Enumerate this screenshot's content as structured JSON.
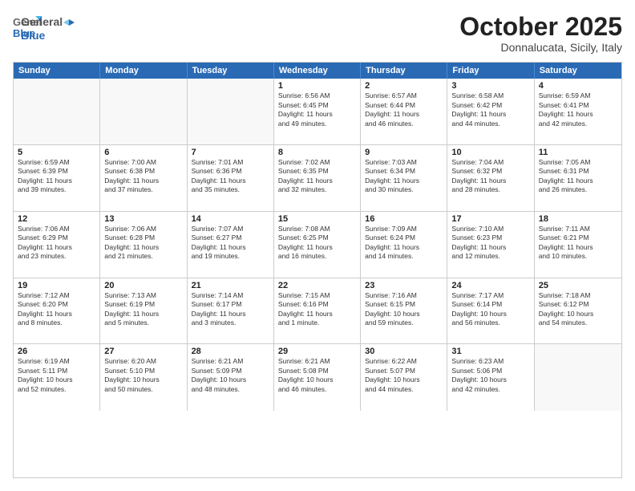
{
  "header": {
    "logo": {
      "general": "General",
      "blue": "Blue"
    },
    "title": "October 2025",
    "location": "Donnalucata, Sicily, Italy"
  },
  "dayHeaders": [
    "Sunday",
    "Monday",
    "Tuesday",
    "Wednesday",
    "Thursday",
    "Friday",
    "Saturday"
  ],
  "weeks": [
    [
      {
        "date": "",
        "info": ""
      },
      {
        "date": "",
        "info": ""
      },
      {
        "date": "",
        "info": ""
      },
      {
        "date": "1",
        "info": "Sunrise: 6:56 AM\nSunset: 6:45 PM\nDaylight: 11 hours\nand 49 minutes."
      },
      {
        "date": "2",
        "info": "Sunrise: 6:57 AM\nSunset: 6:44 PM\nDaylight: 11 hours\nand 46 minutes."
      },
      {
        "date": "3",
        "info": "Sunrise: 6:58 AM\nSunset: 6:42 PM\nDaylight: 11 hours\nand 44 minutes."
      },
      {
        "date": "4",
        "info": "Sunrise: 6:59 AM\nSunset: 6:41 PM\nDaylight: 11 hours\nand 42 minutes."
      }
    ],
    [
      {
        "date": "5",
        "info": "Sunrise: 6:59 AM\nSunset: 6:39 PM\nDaylight: 11 hours\nand 39 minutes."
      },
      {
        "date": "6",
        "info": "Sunrise: 7:00 AM\nSunset: 6:38 PM\nDaylight: 11 hours\nand 37 minutes."
      },
      {
        "date": "7",
        "info": "Sunrise: 7:01 AM\nSunset: 6:36 PM\nDaylight: 11 hours\nand 35 minutes."
      },
      {
        "date": "8",
        "info": "Sunrise: 7:02 AM\nSunset: 6:35 PM\nDaylight: 11 hours\nand 32 minutes."
      },
      {
        "date": "9",
        "info": "Sunrise: 7:03 AM\nSunset: 6:34 PM\nDaylight: 11 hours\nand 30 minutes."
      },
      {
        "date": "10",
        "info": "Sunrise: 7:04 AM\nSunset: 6:32 PM\nDaylight: 11 hours\nand 28 minutes."
      },
      {
        "date": "11",
        "info": "Sunrise: 7:05 AM\nSunset: 6:31 PM\nDaylight: 11 hours\nand 26 minutes."
      }
    ],
    [
      {
        "date": "12",
        "info": "Sunrise: 7:06 AM\nSunset: 6:29 PM\nDaylight: 11 hours\nand 23 minutes."
      },
      {
        "date": "13",
        "info": "Sunrise: 7:06 AM\nSunset: 6:28 PM\nDaylight: 11 hours\nand 21 minutes."
      },
      {
        "date": "14",
        "info": "Sunrise: 7:07 AM\nSunset: 6:27 PM\nDaylight: 11 hours\nand 19 minutes."
      },
      {
        "date": "15",
        "info": "Sunrise: 7:08 AM\nSunset: 6:25 PM\nDaylight: 11 hours\nand 16 minutes."
      },
      {
        "date": "16",
        "info": "Sunrise: 7:09 AM\nSunset: 6:24 PM\nDaylight: 11 hours\nand 14 minutes."
      },
      {
        "date": "17",
        "info": "Sunrise: 7:10 AM\nSunset: 6:23 PM\nDaylight: 11 hours\nand 12 minutes."
      },
      {
        "date": "18",
        "info": "Sunrise: 7:11 AM\nSunset: 6:21 PM\nDaylight: 11 hours\nand 10 minutes."
      }
    ],
    [
      {
        "date": "19",
        "info": "Sunrise: 7:12 AM\nSunset: 6:20 PM\nDaylight: 11 hours\nand 8 minutes."
      },
      {
        "date": "20",
        "info": "Sunrise: 7:13 AM\nSunset: 6:19 PM\nDaylight: 11 hours\nand 5 minutes."
      },
      {
        "date": "21",
        "info": "Sunrise: 7:14 AM\nSunset: 6:17 PM\nDaylight: 11 hours\nand 3 minutes."
      },
      {
        "date": "22",
        "info": "Sunrise: 7:15 AM\nSunset: 6:16 PM\nDaylight: 11 hours\nand 1 minute."
      },
      {
        "date": "23",
        "info": "Sunrise: 7:16 AM\nSunset: 6:15 PM\nDaylight: 10 hours\nand 59 minutes."
      },
      {
        "date": "24",
        "info": "Sunrise: 7:17 AM\nSunset: 6:14 PM\nDaylight: 10 hours\nand 56 minutes."
      },
      {
        "date": "25",
        "info": "Sunrise: 7:18 AM\nSunset: 6:12 PM\nDaylight: 10 hours\nand 54 minutes."
      }
    ],
    [
      {
        "date": "26",
        "info": "Sunrise: 6:19 AM\nSunset: 5:11 PM\nDaylight: 10 hours\nand 52 minutes."
      },
      {
        "date": "27",
        "info": "Sunrise: 6:20 AM\nSunset: 5:10 PM\nDaylight: 10 hours\nand 50 minutes."
      },
      {
        "date": "28",
        "info": "Sunrise: 6:21 AM\nSunset: 5:09 PM\nDaylight: 10 hours\nand 48 minutes."
      },
      {
        "date": "29",
        "info": "Sunrise: 6:21 AM\nSunset: 5:08 PM\nDaylight: 10 hours\nand 46 minutes."
      },
      {
        "date": "30",
        "info": "Sunrise: 6:22 AM\nSunset: 5:07 PM\nDaylight: 10 hours\nand 44 minutes."
      },
      {
        "date": "31",
        "info": "Sunrise: 6:23 AM\nSunset: 5:06 PM\nDaylight: 10 hours\nand 42 minutes."
      },
      {
        "date": "",
        "info": ""
      }
    ]
  ]
}
